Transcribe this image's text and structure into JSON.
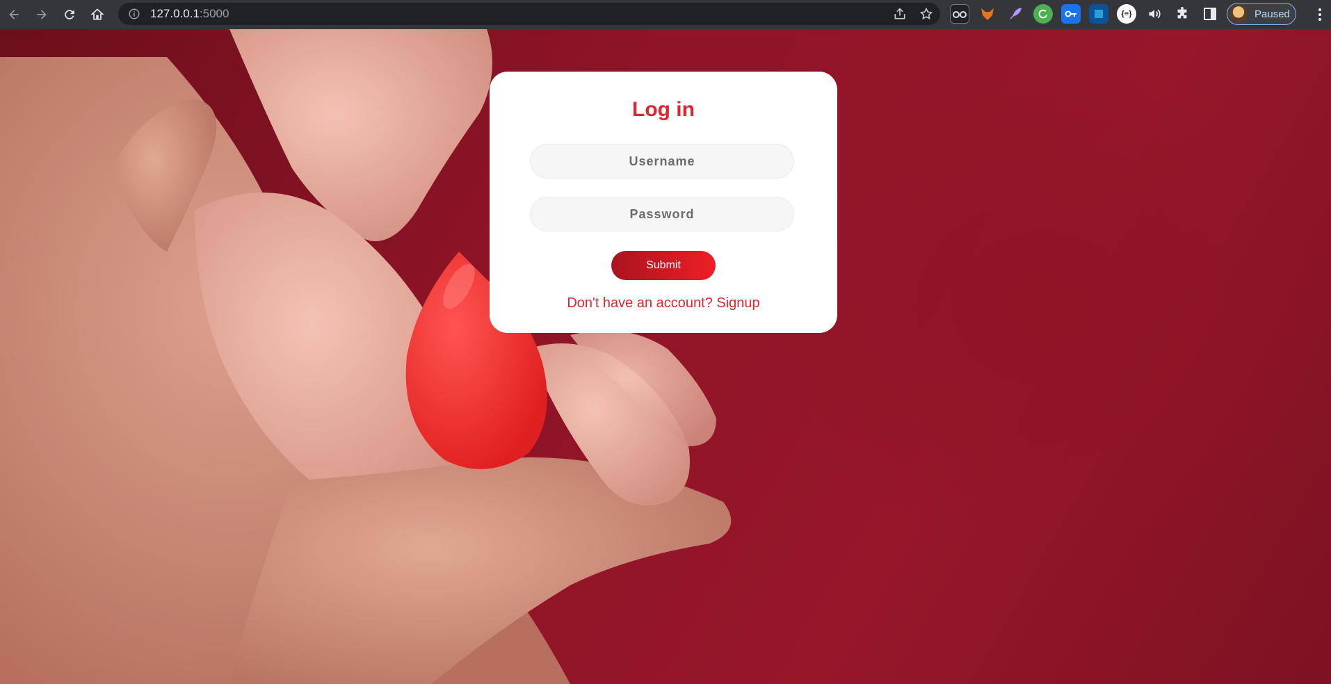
{
  "browser": {
    "url_host": "127.0.0.1",
    "url_port": ":5000",
    "profile_label": "Paused",
    "extensions": [
      "glasses-extension-icon",
      "fox-extension-icon",
      "rocket-extension-icon",
      "refresh-extension-icon",
      "key-extension-icon",
      "square-extension-icon",
      "json-extension-icon",
      "speaker-icon",
      "puzzle-icon",
      "sidepanel-icon"
    ],
    "json_ext_label": "{≡}"
  },
  "login": {
    "title": "Log in",
    "username_placeholder": "Username",
    "password_placeholder": "Password",
    "submit_label": "Submit",
    "signup_text": "Don't have an account? Signup"
  },
  "colors": {
    "accent": "#e0252f",
    "background": "#8f1427",
    "card": "#ffffff"
  }
}
